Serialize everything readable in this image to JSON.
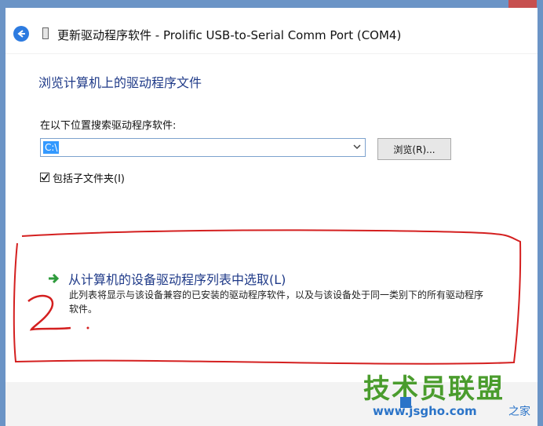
{
  "window": {
    "title": "更新驱动程序软件 - Prolific USB-to-Serial Comm Port (COM4)"
  },
  "main": {
    "heading": "浏览计算机上的驱动程序文件",
    "search_label": "在以下位置搜索驱动程序软件:",
    "path_value": "C:\\",
    "browse_label": "浏览(R)...",
    "include_subfolders_label": "包括子文件夹(I)",
    "include_subfolders_checked": true
  },
  "option": {
    "title": "从计算机的设备驱动程序列表中选取(L)",
    "description": "此列表将显示与该设备兼容的已安装的驱动程序软件，以及与该设备处于同一类别下的所有驱动程序软件。"
  },
  "annotation": {
    "handwritten_number": "2"
  },
  "watermark": {
    "site_name": "技术员联盟",
    "url": "www.jsgho.com",
    "side_text": "之家"
  },
  "colors": {
    "frame": "#6b94c6",
    "heading_blue": "#1f3a88",
    "annotation_red": "#d42020",
    "watermark_green": "#4a9c2d",
    "watermark_blue": "#2b74c8"
  }
}
